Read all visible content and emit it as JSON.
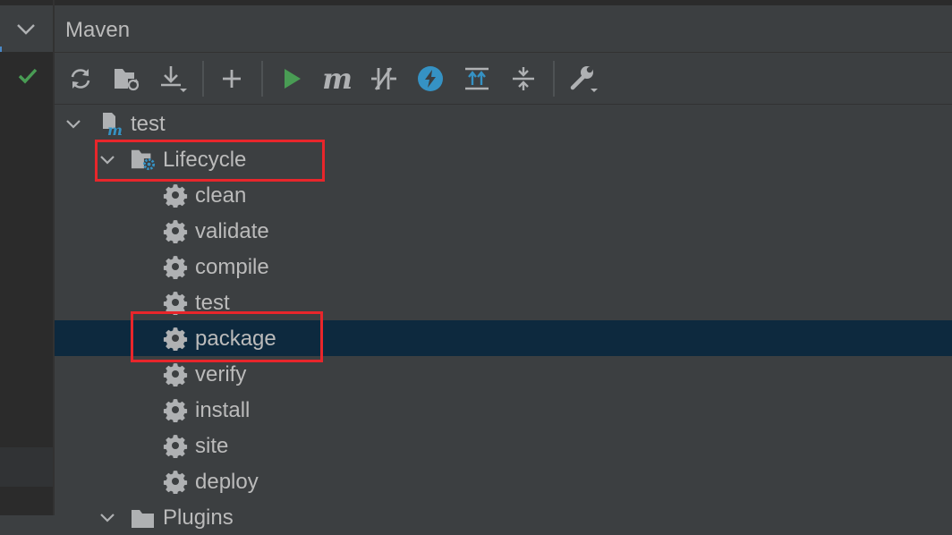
{
  "window": {
    "title": "Maven"
  },
  "colors": {
    "accent_blue": "#4a88c7",
    "run_green": "#499c54",
    "highlight_red": "#e8262b",
    "selection": "#0d293e"
  },
  "toolbar": {
    "buttons": [
      {
        "name": "reload-all-maven-projects",
        "icon": "refresh-icon"
      },
      {
        "name": "generate-sources-and-update-folders",
        "icon": "folder-refresh-icon"
      },
      {
        "name": "download-sources",
        "icon": "download-icon"
      },
      {
        "name": "add-maven-project",
        "icon": "plus-icon"
      },
      {
        "name": "run-maven-build",
        "icon": "run-icon"
      },
      {
        "name": "execute-maven-goal",
        "icon": "maven-m-icon",
        "text": "m"
      },
      {
        "name": "toggle-offline-mode",
        "icon": "offline-icon"
      },
      {
        "name": "skip-tests-mode",
        "icon": "lightning-icon"
      },
      {
        "name": "show-dependencies",
        "icon": "expand-all-icon"
      },
      {
        "name": "collapse-all",
        "icon": "collapse-all-icon"
      },
      {
        "name": "maven-settings",
        "icon": "wrench-icon"
      }
    ]
  },
  "tree": {
    "project": {
      "label": "test"
    },
    "lifecycle": {
      "label": "Lifecycle",
      "goals": [
        "clean",
        "validate",
        "compile",
        "test",
        "package",
        "verify",
        "install",
        "site",
        "deploy"
      ],
      "selected": "package"
    },
    "plugins": {
      "label": "Plugins"
    }
  }
}
